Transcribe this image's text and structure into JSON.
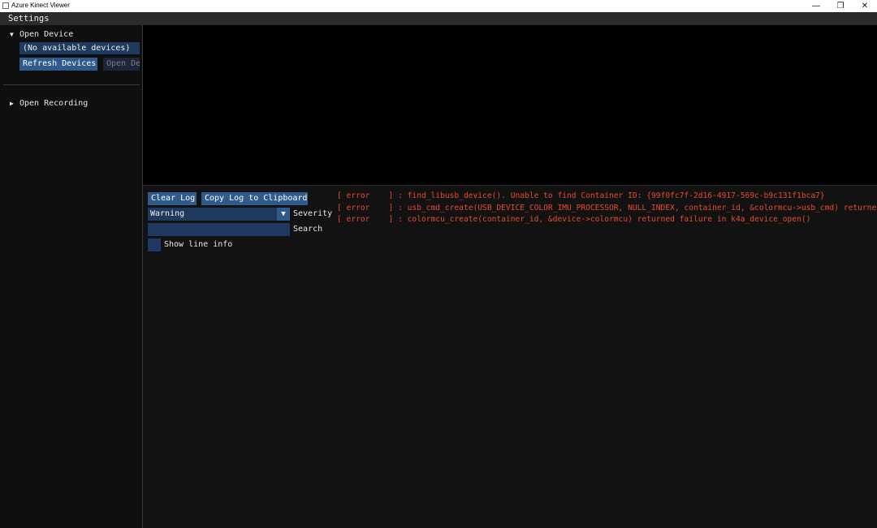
{
  "window": {
    "title": "Azure Kinect Viewer",
    "minimize_glyph": "—",
    "maximize_glyph": "❐",
    "close_glyph": "✕"
  },
  "menu": {
    "settings_label": "Settings"
  },
  "sidebar": {
    "open_device": {
      "arrow": "▼",
      "label": "Open Device"
    },
    "device_list_text": "(No available devices)",
    "refresh_button": "Refresh Devices",
    "open_device_button": "Open Device",
    "open_recording": {
      "arrow": "▶",
      "label": "Open Recording"
    }
  },
  "log": {
    "clear_button": "Clear Log",
    "copy_button": "Copy Log to Clipboard",
    "severity": {
      "value": "Warning",
      "label": "Severity",
      "arrow": "▼"
    },
    "search": {
      "value": "",
      "placeholder": "",
      "label": "Search"
    },
    "show_line_info": {
      "label": "Show line info",
      "checked": false
    },
    "lines": [
      {
        "level": "[ error    ]",
        "message": " : find_libusb_device(). Unable to find Container ID: {99f0fc7f-2d16-4917-569c-b9c131f1bca7}"
      },
      {
        "level": "[ error    ]",
        "message": " : usb_cmd_create(USB_DEVICE_COLOR_IMU_PROCESSOR, NULL_INDEX, container_id, &colormcu->usb_cmd) returned failure"
      },
      {
        "level": "[ error    ]",
        "message": " : colormcu_create(container_id, &device->colormcu) returned failure in k4a_device_open()"
      }
    ]
  },
  "colors": {
    "accent": "#2f5a8e",
    "frame": "#1f3a5e",
    "error_text": "#e84a2c",
    "background": "#121212"
  }
}
